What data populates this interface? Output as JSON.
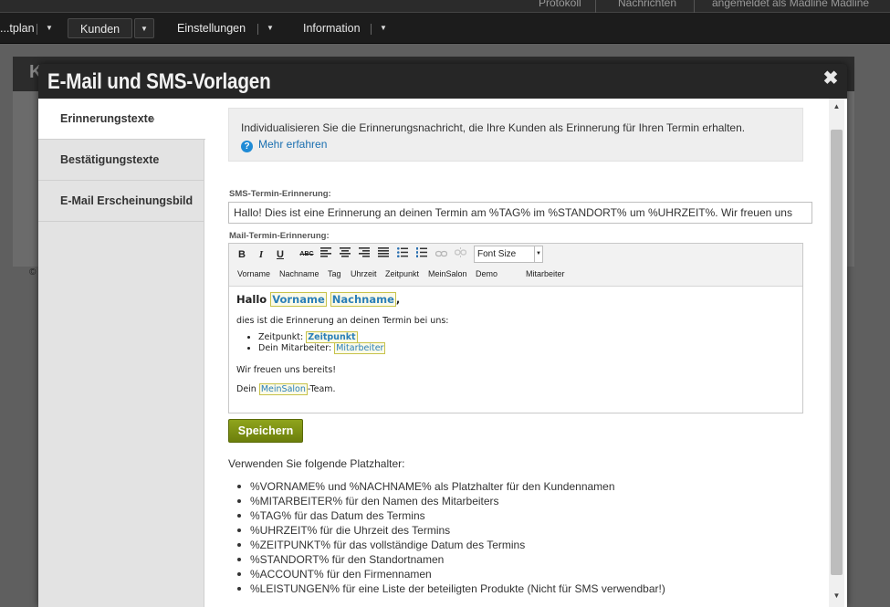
{
  "topbar": {
    "items": [
      "Protokoll",
      "Nachrichten",
      "angemeldet als Madline Madline"
    ]
  },
  "nav": {
    "items": [
      {
        "label": "...tplan"
      },
      {
        "label": "Kunden"
      },
      {
        "label": "Einstellungen"
      },
      {
        "label": "Information"
      }
    ],
    "dropdown_glyph": "▼"
  },
  "background": {
    "header_letter": "K",
    "footer_symbol": "©"
  },
  "modal": {
    "title": "E-Mail und SMS-Vorlagen",
    "close_glyph": "✖"
  },
  "sidebar": {
    "items": [
      {
        "label": "Erinnerungstexte",
        "active": true
      },
      {
        "label": "Bestätigungstexte",
        "active": false
      },
      {
        "label": "E-Mail Erscheinungsbild",
        "active": false
      }
    ],
    "active_chevron": "»"
  },
  "info": {
    "text": "Individualisieren Sie die Erinnerungsnachricht, die Ihre Kunden als Erinnerung für Ihren Termin erhalten.",
    "link": "Mehr erfahren",
    "icon": "?"
  },
  "sms": {
    "label": "SMS-Termin-Erinnerung:",
    "value": "Hallo! Dies ist eine Erinnerung an deinen Termin am %TAG% im %STANDORT% um %UHRZEIT%. Wir freuen uns"
  },
  "mail": {
    "label": "Mail-Termin-Erinnerung:",
    "toolbar": {
      "bold": "B",
      "italic": "I",
      "underline": "U",
      "strike": "ABC",
      "font_size": "Font Size",
      "placeholders": [
        "Vorname",
        "Nachname",
        "Tag",
        "Uhrzeit",
        "Zeitpunkt",
        "MeinSalon",
        "Demo",
        "Mitarbeiter"
      ]
    },
    "body": {
      "greeting": "Hallo",
      "greeting_ph1": "Vorname",
      "greeting_ph2": "Nachname",
      "greeting_end": ",",
      "intro": "dies ist die Erinnerung an deinen Termin bei uns:",
      "bullet1_label": "Zeitpunkt:",
      "bullet1_ph": "Zeitpunkt",
      "bullet2_label": "Dein Mitarbeiter:",
      "bullet2_ph": "Mitarbeiter",
      "closing": "Wir freuen uns bereits!",
      "sign_pre": "Dein",
      "sign_ph": "MeinSalon",
      "sign_post": "-Team."
    }
  },
  "save_button": "Speichern",
  "placeholder_help": {
    "intro": "Verwenden Sie folgende Platzhalter:",
    "items": [
      "%VORNAME% und %NACHNAME% als Platzhalter für den Kundennamen",
      "%MITARBEITER% für den Namen des Mitarbeiters",
      "%TAG% für das Datum des Termins",
      "%UHRZEIT% für die Uhrzeit des Termins",
      "%ZEITPUNKT% für das vollständige Datum des Termins",
      "%STANDORT% für den Standortnamen",
      "%ACCOUNT% für den Firmennamen",
      "%LEISTUNGEN% für eine Liste der beteiligten Produkte (Nicht für SMS verwendbar!)"
    ]
  },
  "scrollbar": {
    "up": "▲",
    "down": "▼"
  },
  "colors": {
    "accent_green": "#7a8f12",
    "link_blue": "#1a6fb0",
    "placeholder_border": "#c7c24a"
  }
}
